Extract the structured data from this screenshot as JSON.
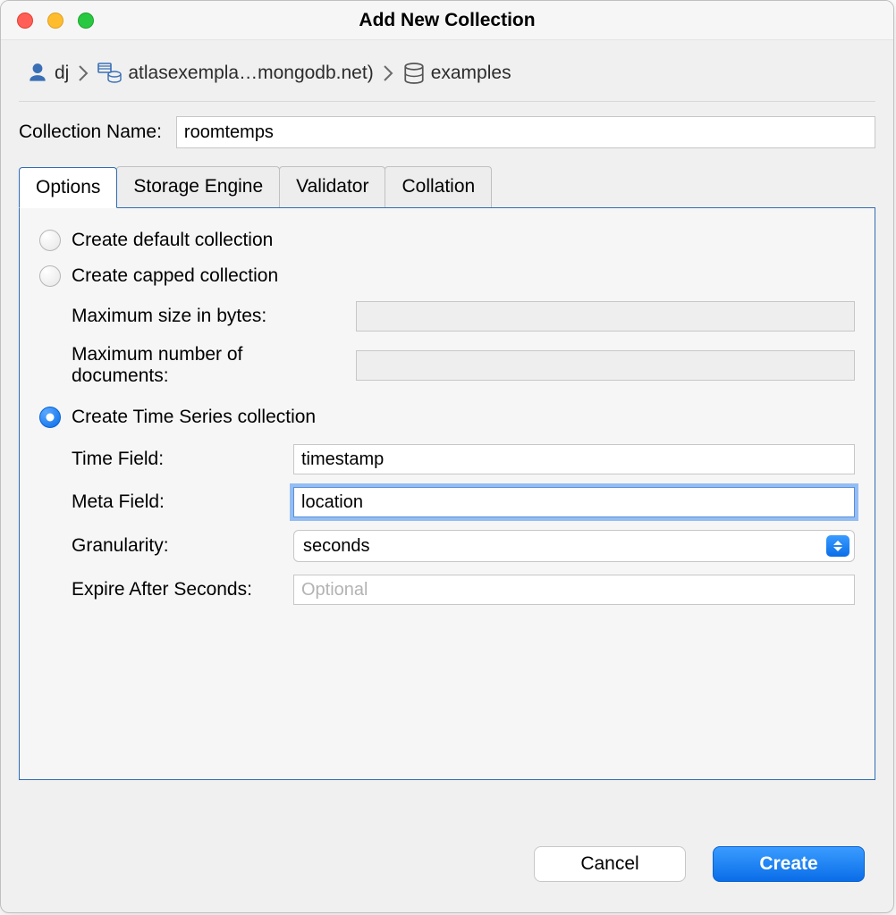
{
  "window": {
    "title": "Add New Collection"
  },
  "breadcrumb": {
    "user": "dj",
    "cluster": "atlasexempla…mongodb.net)",
    "database": "examples"
  },
  "collectionName": {
    "label": "Collection Name:",
    "value": "roomtemps"
  },
  "tabs": {
    "options": "Options",
    "storageEngine": "Storage Engine",
    "validator": "Validator",
    "collation": "Collation"
  },
  "options": {
    "defaultLabel": "Create default collection",
    "cappedLabel": "Create capped collection",
    "capped": {
      "maxSizeLabel": "Maximum size in bytes:",
      "maxSizeValue": "",
      "maxDocsLabel": "Maximum number of documents:",
      "maxDocsValue": ""
    },
    "tsLabel": "Create Time Series collection",
    "ts": {
      "timeFieldLabel": "Time Field:",
      "timeFieldValue": "timestamp",
      "metaFieldLabel": "Meta Field:",
      "metaFieldValue": "location",
      "granularityLabel": "Granularity:",
      "granularityValue": "seconds",
      "expireLabel": "Expire After Seconds:",
      "expirePlaceholder": "Optional",
      "expireValue": ""
    }
  },
  "footer": {
    "cancel": "Cancel",
    "create": "Create"
  }
}
